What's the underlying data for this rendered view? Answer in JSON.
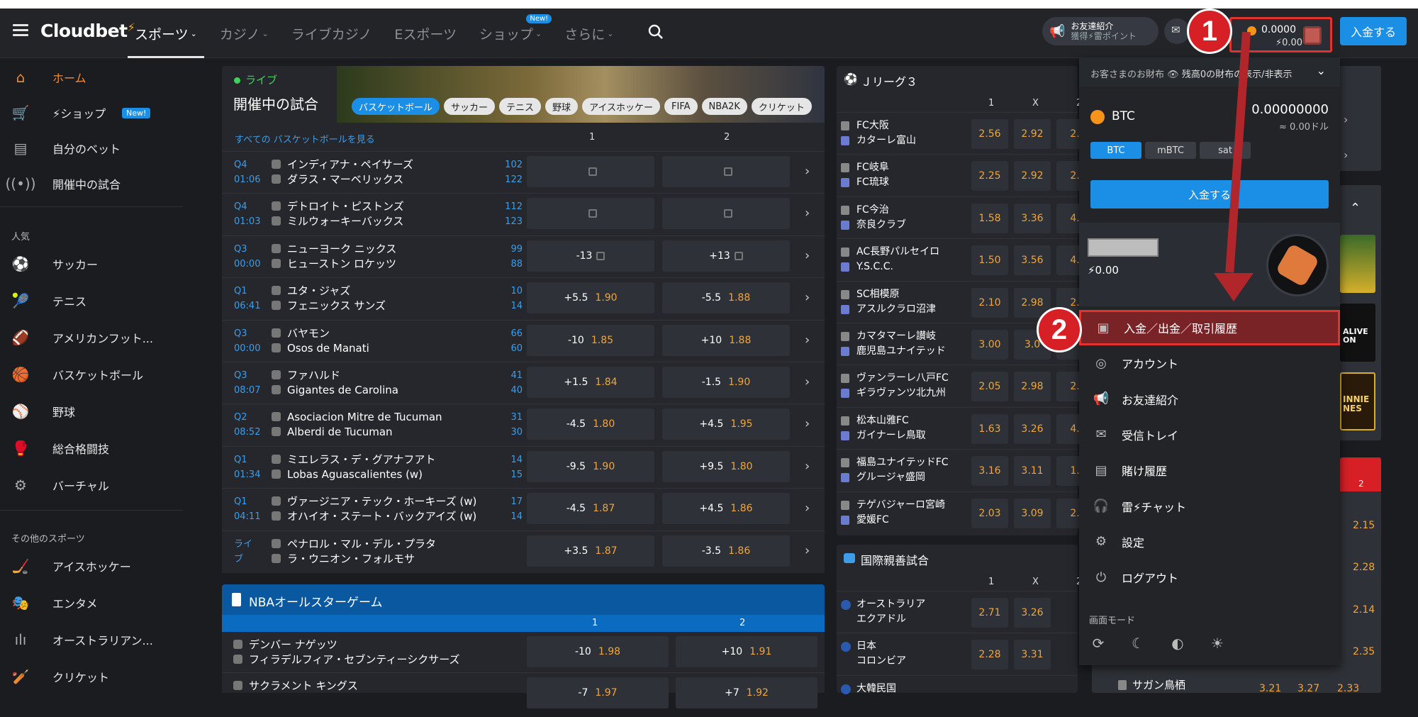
{
  "header": {
    "logo": "Cloudbet",
    "nav": [
      {
        "label": "スポーツ",
        "chev": "⌄",
        "active": true
      },
      {
        "label": "カジノ",
        "chev": "⌄"
      },
      {
        "label": "ライブカジノ"
      },
      {
        "label": "Eスポーツ"
      },
      {
        "label": "ショップ",
        "chev": "⌄",
        "badge": "New!"
      },
      {
        "label": "さらに",
        "chev": "⌄"
      }
    ],
    "refer_line1": "お友達紹介",
    "refer_line2": "獲得⚡雷ポイント",
    "wallet_btc": "0.0000",
    "wallet_bolt": "⚡0.00",
    "deposit": "入金する",
    "callout1": "1",
    "callout2": "2"
  },
  "sidebar": {
    "main": [
      {
        "label": "ホーム",
        "icon": "home-icon",
        "glyph": "⌂",
        "active": true
      },
      {
        "label": "⚡ショップ",
        "icon": "cart-icon",
        "glyph": "🛒",
        "badge": "New!"
      },
      {
        "label": "自分のベット",
        "icon": "betslip-icon",
        "glyph": "▤"
      },
      {
        "label": "開催中の試合",
        "icon": "live-icon",
        "glyph": "((•))"
      }
    ],
    "popular_title": "人気",
    "popular": [
      {
        "label": "サッカー",
        "icon": "soccer-icon",
        "glyph": "⚽"
      },
      {
        "label": "テニス",
        "icon": "tennis-icon",
        "glyph": "🎾"
      },
      {
        "label": "アメリカンフット...",
        "icon": "football-icon",
        "glyph": "🏈"
      },
      {
        "label": "バスケットボール",
        "icon": "basketball-icon",
        "glyph": "🏀"
      },
      {
        "label": "野球",
        "icon": "baseball-icon",
        "glyph": "⚾"
      },
      {
        "label": "総合格闘技",
        "icon": "mma-icon",
        "glyph": "🥊"
      },
      {
        "label": "バーチャル",
        "icon": "virtual-icon",
        "glyph": "⚙"
      }
    ],
    "other_title": "その他のスポーツ",
    "other": [
      {
        "label": "アイスホッケー",
        "icon": "hockey-icon",
        "glyph": "🏒"
      },
      {
        "label": "エンタメ",
        "icon": "entertainment-icon",
        "glyph": "🎭"
      },
      {
        "label": "オーストラリアン...",
        "icon": "aussie-rules-icon",
        "glyph": "ılı"
      },
      {
        "label": "クリケット",
        "icon": "cricket-icon",
        "glyph": "🏏"
      }
    ]
  },
  "live": {
    "live_label": "ライブ",
    "title": "開催中の試合",
    "chips": [
      "バスケットボール",
      "サッカー",
      "テニス",
      "野球",
      "アイスホッケー",
      "FIFA",
      "NBA2K",
      "クリケット"
    ],
    "see_all": "すべての バスケットボールを見る",
    "col1": "1",
    "col2": "2",
    "matches": [
      {
        "period": "Q4",
        "clock": "01:06",
        "home": "インディアナ・ペイサーズ",
        "away": "ダラス・マーベリックス",
        "s1": "102",
        "s2": "122",
        "o1": "",
        "v1": "",
        "o2": "",
        "v2": "",
        "locked": true
      },
      {
        "period": "Q4",
        "clock": "01:03",
        "home": "デトロイト・ピストンズ",
        "away": "ミルウォーキーバックス",
        "s1": "112",
        "s2": "123",
        "o1": "",
        "v1": "",
        "o2": "",
        "v2": "",
        "locked": true
      },
      {
        "period": "Q3",
        "clock": "00:00",
        "home": "ニューヨーク ニックス",
        "away": "ヒューストン ロケッツ",
        "s1": "99",
        "s2": "88",
        "o1": "-13",
        "v1": "",
        "o2": "+13",
        "v2": "",
        "locked": true
      },
      {
        "period": "Q1",
        "clock": "06:41",
        "home": "ユタ・ジャズ",
        "away": "フェニックス サンズ",
        "s1": "10",
        "s2": "14",
        "o1": "+5.5",
        "v1": "1.90",
        "o2": "-5.5",
        "v2": "1.88"
      },
      {
        "period": "Q3",
        "clock": "00:00",
        "home": "バヤモン",
        "away": "Osos de Manati",
        "s1": "66",
        "s2": "60",
        "o1": "-10",
        "v1": "1.85",
        "o2": "+10",
        "v2": "1.88"
      },
      {
        "period": "Q3",
        "clock": "08:07",
        "home": "ファハルド",
        "away": "Gigantes de Carolina",
        "s1": "41",
        "s2": "40",
        "o1": "+1.5",
        "v1": "1.84",
        "o2": "-1.5",
        "v2": "1.90"
      },
      {
        "period": "Q2",
        "clock": "08:52",
        "home": "Asociacion Mitre de Tucuman",
        "away": "Alberdi de Tucuman",
        "s1": "31",
        "s2": "30",
        "o1": "-4.5",
        "v1": "1.80",
        "o2": "+4.5",
        "v2": "1.95"
      },
      {
        "period": "Q1",
        "clock": "01:34",
        "home": "ミエレラス・デ・グアナフアト",
        "away": "Lobas Aguascalientes (w)",
        "s1": "14",
        "s2": "15",
        "o1": "-9.5",
        "v1": "1.90",
        "o2": "+9.5",
        "v2": "1.80"
      },
      {
        "period": "Q1",
        "clock": "04:11",
        "home": "ヴァージニア・テック・ホーキーズ (w)",
        "away": "オハイオ・ステート・バックアイズ (w)",
        "s1": "17",
        "s2": "14",
        "o1": "-4.5",
        "v1": "1.87",
        "o2": "+4.5",
        "v2": "1.86"
      },
      {
        "period": "ライ",
        "clock": "ブ",
        "home": "ペナロル・マル・デル・プラタ",
        "away": "ラ・ウニオン・フォルモサ",
        "s1": "",
        "s2": "",
        "o1": "+3.5",
        "v1": "1.87",
        "o2": "-3.5",
        "v2": "1.86"
      }
    ]
  },
  "nba": {
    "title": "NBAオールスターゲーム",
    "col1": "1",
    "col2": "2",
    "matches": [
      {
        "home": "デンバー ナゲッツ",
        "away": "フィラデルフィア・セブンティーシクサーズ",
        "o1": "-10",
        "v1": "1.98",
        "o2": "+10",
        "v2": "1.91"
      },
      {
        "home": "サクラメント キングス",
        "away": "",
        "o1": "-7",
        "v1": "1.97",
        "o2": "+7",
        "v2": "1.92"
      }
    ]
  },
  "jleague": {
    "title": "Ｊリーグ３",
    "cols": [
      "1",
      "X",
      "2"
    ],
    "matches": [
      {
        "home": "FC大阪",
        "away": "カターレ富山",
        "odds": [
          "2.56",
          "2.92",
          "2."
        ]
      },
      {
        "home": "FC岐阜",
        "away": "FC琉球",
        "odds": [
          "2.25",
          "2.92",
          "2."
        ]
      },
      {
        "home": "FC今治",
        "away": "奈良クラブ",
        "odds": [
          "1.58",
          "3.36",
          "4."
        ]
      },
      {
        "home": "AC長野パルセイロ",
        "away": "Y.S.C.C.",
        "odds": [
          "1.50",
          "3.56",
          "4."
        ]
      },
      {
        "home": "SC相模原",
        "away": "アスルクラロ沼津",
        "odds": [
          "2.10",
          "2.98",
          "2."
        ]
      },
      {
        "home": "カマタマーレ讃岐",
        "away": "鹿児島ユナイテッド",
        "odds": [
          "3.00",
          "3.0",
          ""
        ]
      },
      {
        "home": "ヴァンラーレ八戸FC",
        "away": "ギラヴァンツ北九州",
        "odds": [
          "2.05",
          "2.98",
          "2."
        ]
      },
      {
        "home": "松本山雅FC",
        "away": "ガイナーレ鳥取",
        "odds": [
          "1.63",
          "3.26",
          "4."
        ]
      },
      {
        "home": "福島ユナイテッドFC",
        "away": "グルージャ盛岡",
        "odds": [
          "3.16",
          "3.11",
          "1."
        ]
      },
      {
        "home": "テゲバジャーロ宮崎",
        "away": "愛媛FC",
        "odds": [
          "2.03",
          "3.09",
          "2."
        ]
      }
    ]
  },
  "intl": {
    "title": "国際親善試合",
    "cols": [
      "1",
      "X",
      "2"
    ],
    "matches": [
      {
        "home": "オーストラリア",
        "away": "エクアドル",
        "odds": [
          "2.71",
          "3.26"
        ]
      },
      {
        "home": "日本",
        "away": "コロンビア",
        "odds": [
          "2.28",
          "3.31"
        ]
      },
      {
        "home": "大韓民国",
        "away": "",
        "odds": [
          "",
          ""
        ]
      }
    ]
  },
  "right_peek": {
    "odds": [
      "2.15",
      "2.28",
      "2.14",
      "2.35"
    ],
    "col2": "2",
    "bottom_team": "サガン鳥栖",
    "bottom_odds": [
      "3.21",
      "3.27",
      "2.33"
    ],
    "tile1": "ALIVE ON",
    "tile2": "INNIE NES"
  },
  "wallet_menu": {
    "top_text": "お客さまのお財布",
    "top_toggle": "残高0の財布の表示/非表示",
    "currency": "BTC",
    "balance": "0.00000000",
    "balance_fiat": "≈ 0.00ドル",
    "units": [
      "BTC",
      "mBTC",
      "sat"
    ],
    "deposit": "入金する",
    "points": "⚡0.00",
    "items": [
      {
        "label": "入金／出金／取引履歴",
        "icon": "wallet-icon",
        "glyph": "▣",
        "highlight": true
      },
      {
        "label": "アカウント",
        "icon": "account-icon",
        "glyph": "◎"
      },
      {
        "label": "お友達紹介",
        "icon": "megaphone-icon",
        "glyph": "📢"
      },
      {
        "label": "受信トレイ",
        "icon": "mail-icon",
        "glyph": "✉"
      },
      {
        "label": "賭け履歴",
        "icon": "history-icon",
        "glyph": "▤"
      },
      {
        "label": "雷⚡チャット",
        "icon": "headset-icon",
        "glyph": "🎧"
      },
      {
        "label": "設定",
        "icon": "settings-icon",
        "glyph": "⚙"
      },
      {
        "label": "ログアウト",
        "icon": "logout-icon",
        "glyph": "⏻"
      }
    ],
    "mode_title": "画面モード",
    "modes": [
      {
        "icon": "auto-mode-icon",
        "glyph": "⟳"
      },
      {
        "icon": "moon-icon",
        "glyph": "☾"
      },
      {
        "icon": "half-moon-icon",
        "glyph": "◐"
      },
      {
        "icon": "sun-icon",
        "glyph": "☀"
      }
    ]
  }
}
